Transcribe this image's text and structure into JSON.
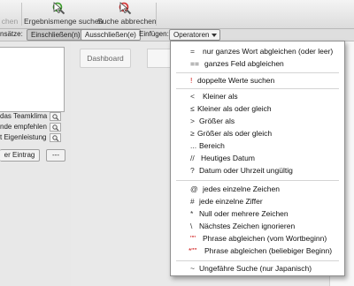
{
  "toolbar": {
    "cut_label": "chen",
    "find_label": "Ergebnismenge suchen",
    "cancel_label": "Suche abbrechen"
  },
  "options": {
    "records_label": "nsätze:",
    "include_label": "Einschließen(n)",
    "exclude_label": "Ausschließen(e)",
    "insert_label": "Einfügen:",
    "operators_label": "Operatoren"
  },
  "left_panel": {
    "fields": [
      "das Teamklima",
      "nde empfehlen",
      "t Eigenleistung"
    ],
    "new_entry_label": "er Eintrag",
    "more_label": "---"
  },
  "main": {
    "dashboard_tab": "Dashboard"
  },
  "menu": {
    "items": [
      {
        "symbol": "=",
        "label": "nur ganzes Wort abgleichen (oder leer)"
      },
      {
        "symbol": "==",
        "label": "ganzes Feld abgleichen"
      },
      {
        "symbol": "!",
        "label": "doppelte Werte suchen"
      },
      {
        "symbol": "<",
        "label": "Kleiner als"
      },
      {
        "symbol": "≤",
        "label": "Kleiner als oder gleich"
      },
      {
        "symbol": ">",
        "label": "Größer als"
      },
      {
        "symbol": "≥",
        "label": "Größer als oder gleich"
      },
      {
        "symbol": "...",
        "label": "Bereich"
      },
      {
        "symbol": "//",
        "label": "Heutiges Datum"
      },
      {
        "symbol": "?",
        "label": "Datum oder Uhrzeit ungültig"
      },
      {
        "symbol": "@",
        "label": "jedes einzelne Zeichen"
      },
      {
        "symbol": "#",
        "label": "jede einzelne Ziffer"
      },
      {
        "symbol": "*",
        "label": "Null oder mehrere Zeichen"
      },
      {
        "symbol": "\\",
        "label": "Nächstes Zeichen ignorieren"
      },
      {
        "symbol": "\"\"",
        "label": "Phrase abgleichen (vom Wortbeginn)"
      },
      {
        "symbol": "*\"\"",
        "label": "Phrase abgleichen (beliebiger Beginn)"
      },
      {
        "symbol": "~",
        "label": "Ungefähre Suche (nur Japanisch)"
      }
    ]
  },
  "colors": {
    "error_symbol": "#d01a1a",
    "find_icon_green": "#3a9a2a",
    "cancel_icon_red": "#d03030"
  }
}
